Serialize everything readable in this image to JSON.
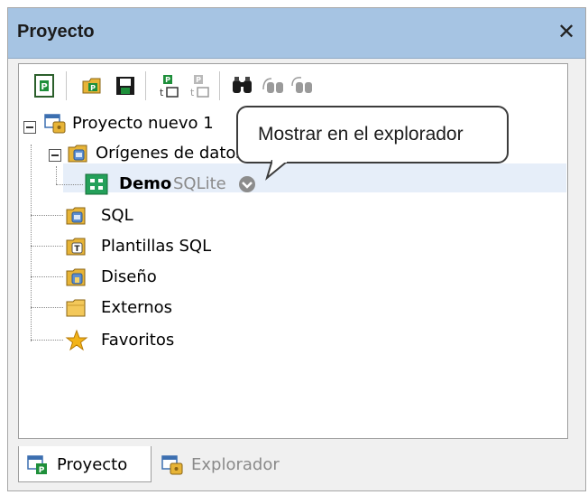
{
  "panel": {
    "title": "Proyecto",
    "close_glyph": "✕"
  },
  "toolbar": {
    "buttons": [
      {
        "icon": "project-properties-icon"
      },
      {
        "icon": "open-project-icon"
      },
      {
        "icon": "save-project-icon"
      },
      {
        "icon": "add-to-project-icon"
      },
      {
        "icon": "add-to-project-disabled-icon"
      },
      {
        "icon": "find-icon"
      },
      {
        "icon": "find-next-icon"
      },
      {
        "icon": "find-previous-icon"
      }
    ]
  },
  "tree": {
    "root": {
      "label": "Proyecto nuevo 1",
      "icon": "project-icon"
    },
    "datasources": {
      "label": "Orígenes de datos",
      "icon": "datasources-folder-icon"
    },
    "demo": {
      "label": "Demo",
      "type_label": "SQLite",
      "icon": "database-connection-icon"
    },
    "items": [
      {
        "label": "SQL",
        "icon": "sql-folder-icon"
      },
      {
        "label": "Plantillas SQL",
        "icon": "sql-templates-folder-icon"
      },
      {
        "label": "Diseño",
        "icon": "design-folder-icon"
      },
      {
        "label": "Externos",
        "icon": "external-folder-icon"
      },
      {
        "label": "Favoritos",
        "icon": "favorites-star-icon"
      }
    ]
  },
  "tooltip": {
    "text": "Mostrar en el explorador"
  },
  "tabs": [
    {
      "label": "Proyecto",
      "icon": "project-tab-icon",
      "active": true
    },
    {
      "label": "Explorador",
      "icon": "explorer-tab-icon",
      "active": false
    }
  ],
  "colors": {
    "titlebar": "#a6c4e3",
    "selection": "#e6eef9",
    "type_label": "#8a8a8a"
  }
}
